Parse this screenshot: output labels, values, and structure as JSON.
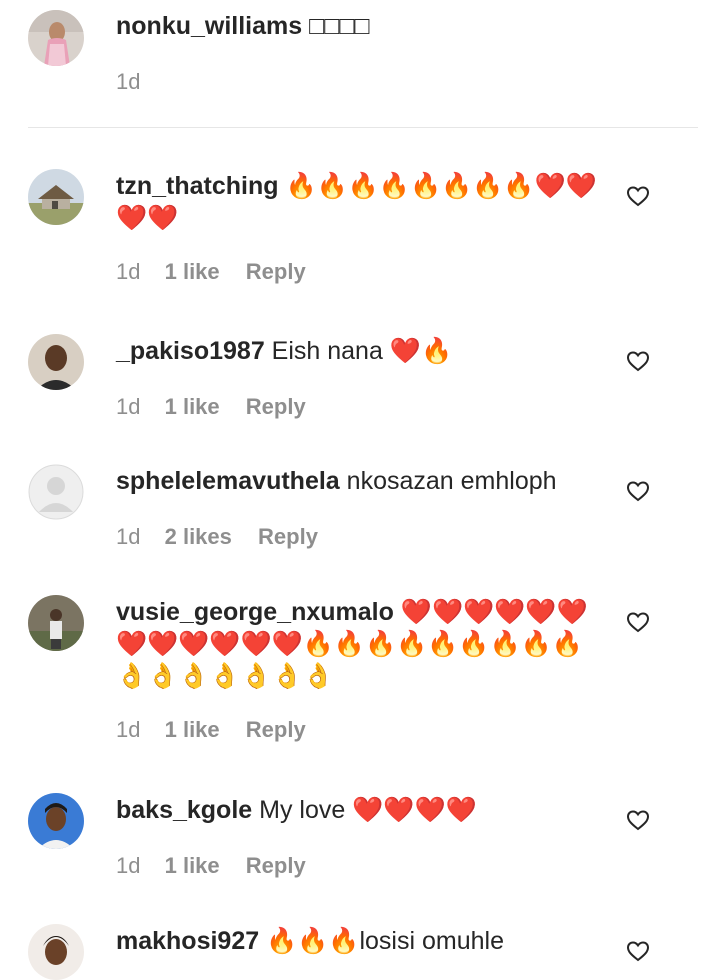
{
  "comments": [
    {
      "username": "nonku_williams",
      "text": "□□□□",
      "time": "1d",
      "likes": "",
      "reply": ""
    },
    {
      "username": "tzn_thatching",
      "text": "🔥🔥🔥🔥🔥🔥🔥🔥❤️❤️❤️❤️",
      "time": "1d",
      "likes": "1 like",
      "reply": "Reply"
    },
    {
      "username": "_pakiso1987",
      "text": "Eish nana ❤️🔥",
      "time": "1d",
      "likes": "1 like",
      "reply": "Reply"
    },
    {
      "username": "sphelelemavuthela",
      "text": "nkosazan emhloph",
      "time": "1d",
      "likes": "2 likes",
      "reply": "Reply"
    },
    {
      "username": "vusie_george_nxumalo",
      "text": "❤️❤️❤️❤️❤️❤️❤️❤️❤️❤️❤️❤️🔥🔥🔥🔥🔥🔥🔥🔥🔥👌👌👌👌👌👌👌",
      "time": "1d",
      "likes": "1 like",
      "reply": "Reply"
    },
    {
      "username": "baks_kgole",
      "text": "My love ❤️❤️❤️❤️",
      "time": "1d",
      "likes": "1 like",
      "reply": "Reply"
    },
    {
      "username": "makhosi927",
      "text": "🔥🔥🔥losisi omuhle",
      "time": "",
      "likes": "",
      "reply": ""
    }
  ]
}
